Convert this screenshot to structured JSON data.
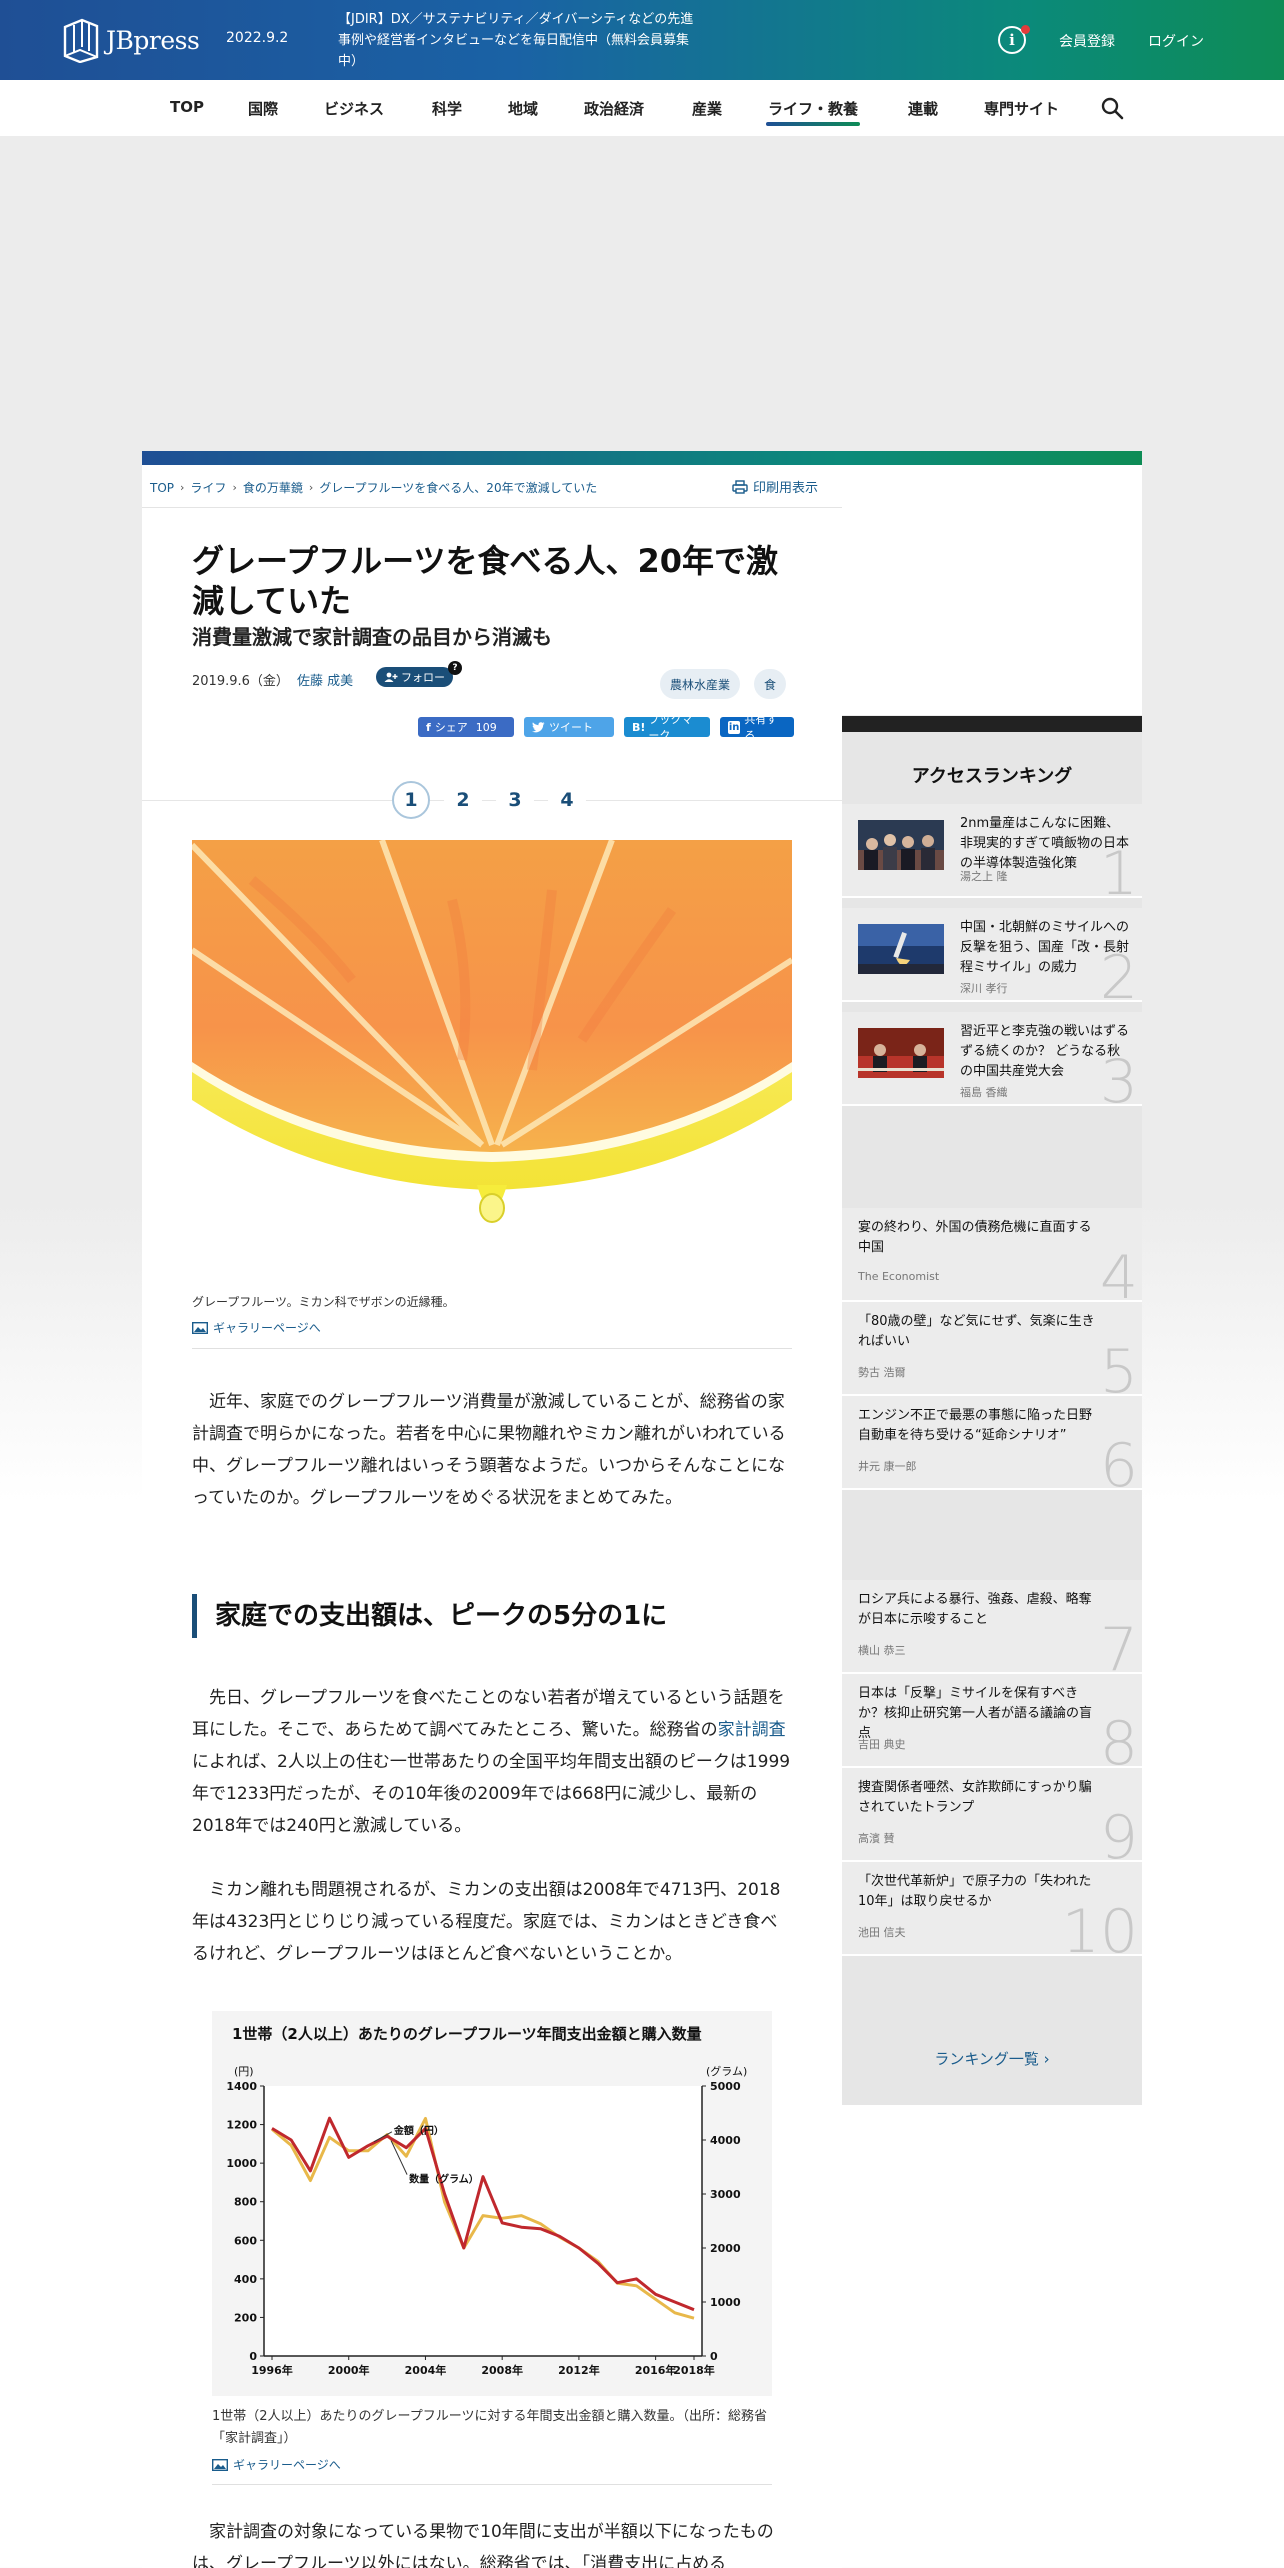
{
  "header": {
    "logo_text": "JBpress",
    "date": "2022.9.2",
    "notice": "【JDIR】DX／サステナビリティ／ダイバーシティなどの先進事例や経営者インタビューなどを毎日配信中（無料会員募集中）",
    "register": "会員登録",
    "login": "ログイン",
    "brand_color": "#1f4f95",
    "accent_color": "#0e8c56"
  },
  "nav": {
    "items": [
      {
        "label": "TOP"
      },
      {
        "label": "国際"
      },
      {
        "label": "ビジネス"
      },
      {
        "label": "科学"
      },
      {
        "label": "地域"
      },
      {
        "label": "政治経済"
      },
      {
        "label": "産業"
      },
      {
        "label": "ライフ・教養",
        "active": true
      },
      {
        "label": "連載"
      },
      {
        "label": "専門サイト"
      }
    ]
  },
  "breadcrumb": [
    "TOP",
    "ライフ",
    "食の万華鏡",
    "グレープフルーツを食べる人、20年で激減していた"
  ],
  "print_label": "印刷用表示",
  "article": {
    "title": "グレープフルーツを食べる人、20年で激減していた",
    "subtitle": "消費量激減で家計調査の品目から消滅も",
    "date": "2019.9.6（金）",
    "author": "佐藤 成美",
    "follow": "フォロー",
    "follow_help": "?",
    "tags": [
      "農林水産業",
      "食"
    ],
    "share": {
      "facebook": "シェア",
      "facebook_count": "109",
      "twitter": "ツイート",
      "hatena": "ブックマーク",
      "linkedin": "共有する"
    },
    "pages": [
      "1",
      "2",
      "3",
      "4"
    ],
    "image_caption": "グレープフルーツ。ミカン科でザボンの近縁種。",
    "gallery_link": "ギャラリーページへ",
    "para1": "　近年、家庭でのグレープフルーツ消費量が激減していることが、総務省の家計調査で明らかになった。若者を中心に果物離れやミカン離れがいわれている中、グレープフルーツ離れはいっそう顕著なようだ。いつからそんなことになっていたのか。グレープフルーツをめぐる状況をまとめてみた。",
    "section1": "家庭での支出額は、ピークの5分の1に",
    "para2_a": "　先日、グレープフルーツを食べたことのない若者が増えているという話題を耳にした。そこで、あらためて調べてみたところ、驚いた。総務省の",
    "para2_link": "家計調査",
    "para2_b": "によれば、2人以上の住む一世帯あたりの全国平均年間支出額のピークは1999年で1233円だったが、その10年後の2009年では668円に減少し、最新の2018年では240円と激減している。",
    "para3": "　ミカン離れも問題視されるが、ミカンの支出額は2008年で4713円、2018年は4323円とじりじり減っている程度だ。家庭では、ミカンはときどき食べるけれど、グレープフルーツはほとんど食べないということか。",
    "chart_caption": "1世帯（2人以上）あたりのグレープフルーツに対する年間支出金額と購入数量。（出所：総務省「家計調査」）",
    "para4": "　家計調査の対象になっている果物で10年間に支出が半額以下になったものは、グレープフルーツ以外にはない。総務省では、「消費支出に占める"
  },
  "chart_data": {
    "type": "line",
    "title": "1世帯（2人以上）あたりのグレープフルーツ年間支出金額と購入数量",
    "left_unit": "(円)",
    "right_unit": "(グラム)",
    "x": [
      1996,
      1997,
      1998,
      1999,
      2000,
      2001,
      2002,
      2003,
      2004,
      2005,
      2006,
      2007,
      2008,
      2009,
      2010,
      2011,
      2012,
      2013,
      2014,
      2015,
      2016,
      2017,
      2018
    ],
    "x_ticks": [
      "1996年",
      "2000年",
      "2004年",
      "2008年",
      "2012年",
      "2016年",
      "2018年"
    ],
    "y_ticks_left": [
      "0",
      "200",
      "400",
      "600",
      "800",
      "1000",
      "1200",
      "1400"
    ],
    "y_ticks_right": [
      "0",
      "1000",
      "2000",
      "3000",
      "4000",
      "5000"
    ],
    "ylim_left": [
      0,
      1400
    ],
    "ylim_right": [
      0,
      5000
    ],
    "series": [
      {
        "name": "金額（円）",
        "axis": "left",
        "color": "#c0282d",
        "values": [
          1180,
          1120,
          960,
          1233,
          1030,
          1090,
          1140,
          1080,
          1180,
          840,
          560,
          930,
          690,
          668,
          660,
          620,
          560,
          480,
          380,
          400,
          320,
          280,
          240
        ]
      },
      {
        "name": "数量（グラム）",
        "axis": "right",
        "color": "#e8b84a",
        "values": [
          4200,
          3900,
          3250,
          4050,
          3800,
          3800,
          4100,
          3700,
          4400,
          2850,
          2000,
          2600,
          2550,
          2600,
          2450,
          2200,
          2000,
          1750,
          1350,
          1300,
          1050,
          800,
          700
        ]
      }
    ]
  },
  "ranking": {
    "title": "アクセスランキング",
    "more": "ランキング一覧",
    "items": [
      {
        "rank": "1",
        "title": "2nm量産はこんなに困難、非現実的すぎて噴飯物の日本の半導体製造強化策",
        "author": "湯之上 隆"
      },
      {
        "rank": "2",
        "title": "中国・北朝鮮のミサイルへの反撃を狙う、国産「改・長射程ミサイル」の威力",
        "author": "深川 孝行"
      },
      {
        "rank": "3",
        "title": "習近平と李克強の戦いはずるずる続くのか？ どうなる秋の中国共産党大会",
        "author": "福島 香織"
      },
      {
        "rank": "4",
        "title": "宴の終わり、外国の債務危機に直面する中国",
        "author": "The Economist"
      },
      {
        "rank": "5",
        "title": "「80歳の壁」など気にせず、気楽に生きればいい",
        "author": "勢古 浩爾"
      },
      {
        "rank": "6",
        "title": "エンジン不正で最悪の事態に陥った日野自動車を待ち受ける“延命シナリオ”",
        "author": "井元 康一郎"
      },
      {
        "rank": "7",
        "title": "ロシア兵による暴行、強姦、虐殺、略奪が日本に示唆すること",
        "author": "横山 恭三"
      },
      {
        "rank": "8",
        "title": "日本は「反撃」ミサイルを保有すべきか？核抑止研究第一人者が語る議論の盲点",
        "author": "吉田 典史"
      },
      {
        "rank": "9",
        "title": "捜査関係者唖然、女詐欺師にすっかり騙されていたトランプ",
        "author": "高濱 賛"
      },
      {
        "rank": "10",
        "title": "「次世代革新炉」で原子力の「失われた10年」は取り戻せるか",
        "author": "池田 信夫"
      }
    ]
  }
}
